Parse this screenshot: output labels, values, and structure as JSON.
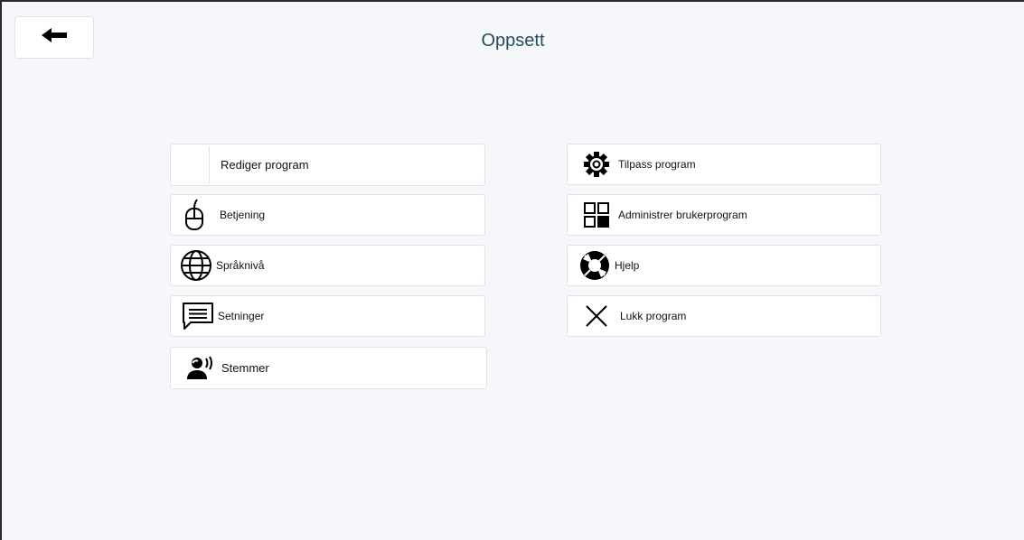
{
  "header": {
    "title": "Oppsett",
    "back_icon": "arrow-left-icon"
  },
  "left_menu": [
    {
      "label": "Rediger program",
      "icon": "none"
    },
    {
      "label": "Betjening",
      "icon": "mouse-icon"
    },
    {
      "label": "Språknivå",
      "icon": "globe-icon"
    },
    {
      "label": "Setninger",
      "icon": "speech-bubble-icon"
    },
    {
      "label": "Stemmer",
      "icon": "speaking-person-icon"
    }
  ],
  "right_menu": [
    {
      "label": "Tilpass program",
      "icon": "gear-icon"
    },
    {
      "label": "Administrer brukerprogram",
      "icon": "grid-icon"
    },
    {
      "label": "Hjelp",
      "icon": "lifebuoy-icon"
    },
    {
      "label": "Lukk program",
      "icon": "close-icon"
    }
  ]
}
